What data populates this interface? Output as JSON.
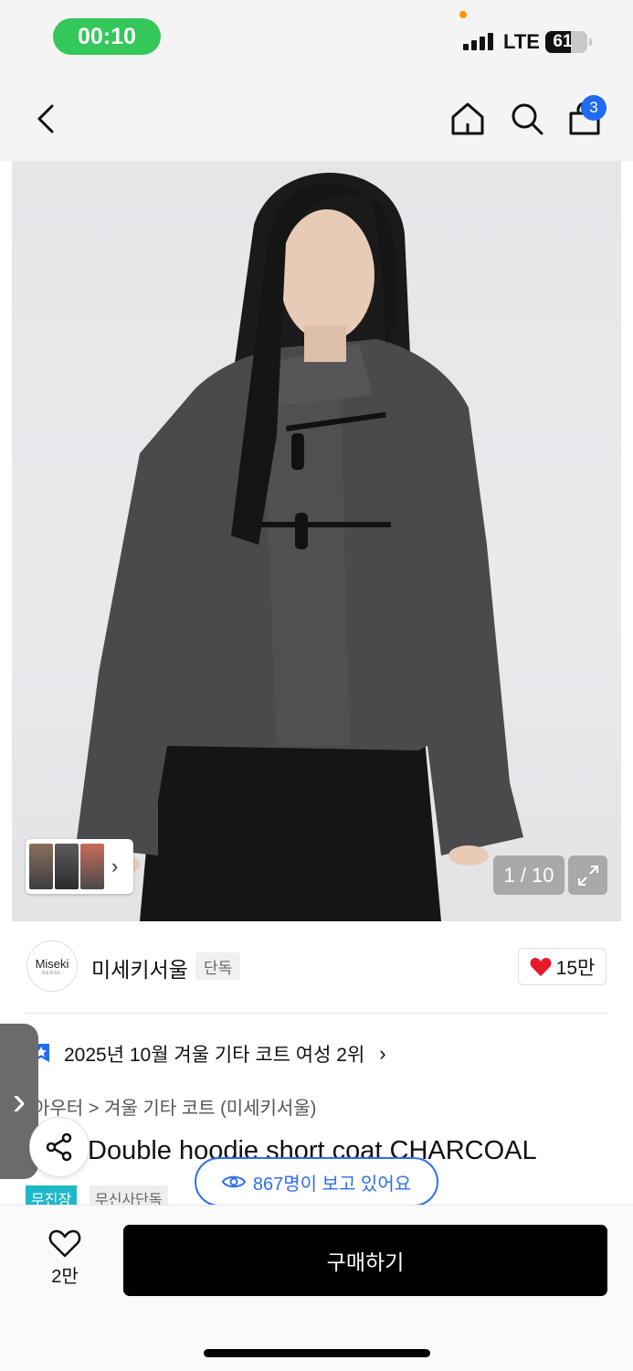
{
  "status_bar": {
    "time": "00:10",
    "network": "LTE",
    "battery_level": 61,
    "battery_text": "61"
  },
  "nav": {
    "cart_count": "3"
  },
  "gallery": {
    "counter": "1 / 10"
  },
  "brand": {
    "logo_text": "Miseki",
    "logo_subtext": "SEOUL",
    "name": "미세키서울",
    "badge": "단독",
    "like_count": "15만"
  },
  "ranking": {
    "text": "2025년 10월 겨울 기타 코트 여성 2위"
  },
  "category": {
    "path": "아우터 > 겨울 기타 코트 (미세키서울)"
  },
  "product": {
    "title": "Double hoodie short coat CHARCOAL",
    "tags": [
      "무진장",
      "무신사단독"
    ]
  },
  "viewers": {
    "text": "867명이 보고 있어요"
  },
  "bottom": {
    "wish_count": "2만",
    "buy_label": "구매하기"
  },
  "colors": {
    "accent_blue": "#2f6ef2",
    "status_green": "#34c759",
    "tag_teal": "#1fb8c9",
    "heart_red": "#e8192c"
  },
  "icons": [
    "back-arrow-icon",
    "home-icon",
    "search-icon",
    "cart-icon",
    "expand-icon",
    "heart-icon",
    "eye-icon",
    "share-icon",
    "ranking-badge-icon"
  ]
}
